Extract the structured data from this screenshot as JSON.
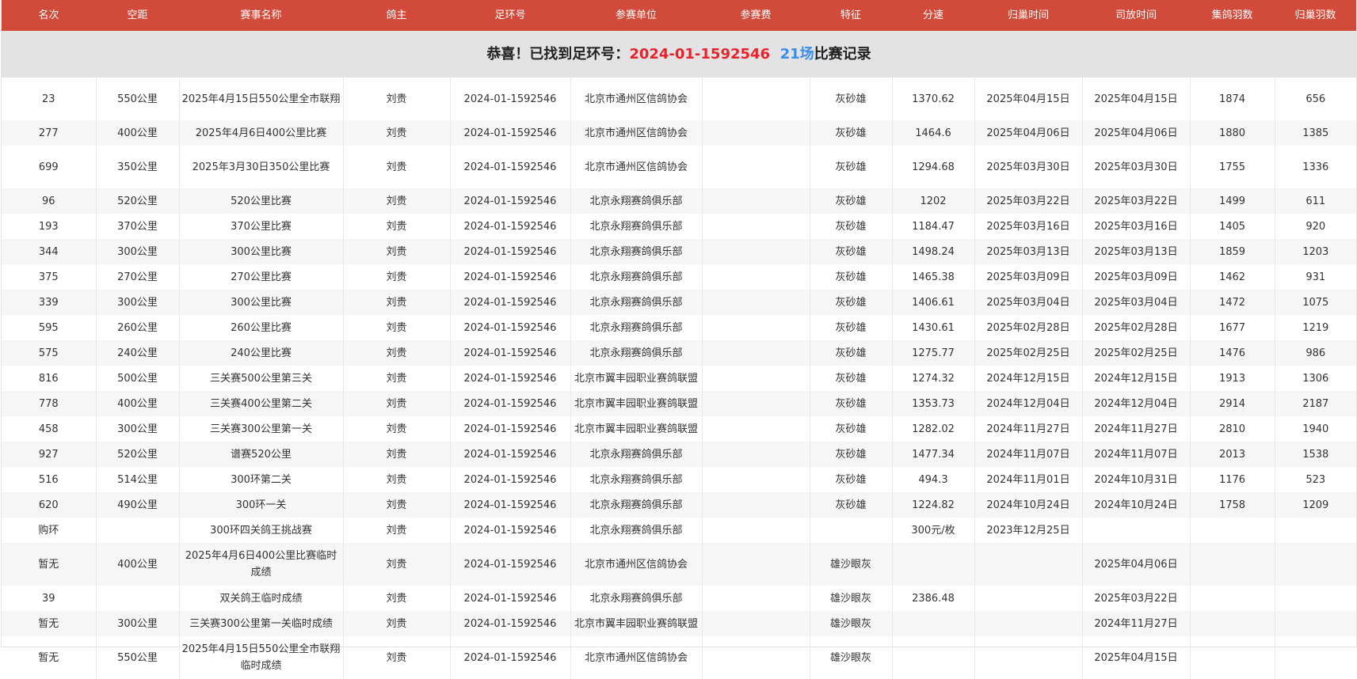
{
  "table": {
    "headers": [
      "名次",
      "空距",
      "赛事名称",
      "鸽主",
      "足环号",
      "参赛单位",
      "参赛费",
      "特征",
      "分速",
      "归巢时间",
      "司放时间",
      "集鸽羽数",
      "归巢羽数"
    ],
    "notice": {
      "prefix": "恭喜！已找到足环号：",
      "ring": "2024-01-1592546",
      "count": "21场",
      "suffix": "比赛记录"
    },
    "rows": [
      [
        "23",
        "550公里",
        "2025年4月15日550公里全市联翔",
        "刘贵",
        "2024-01-1592546",
        "北京市通州区信鸽协会",
        "",
        "灰砂雄",
        "1370.62",
        "2025年04月15日",
        "2025年04月15日",
        "1874",
        "656"
      ],
      [
        "277",
        "400公里",
        "2025年4月6日400公里比赛",
        "刘贵",
        "2024-01-1592546",
        "北京市通州区信鸽协会",
        "",
        "灰砂雄",
        "1464.6",
        "2025年04月06日",
        "2025年04月06日",
        "1880",
        "1385"
      ],
      [
        "699",
        "350公里",
        "2025年3月30日350公里比赛",
        "刘贵",
        "2024-01-1592546",
        "北京市通州区信鸽协会",
        "",
        "灰砂雄",
        "1294.68",
        "2025年03月30日",
        "2025年03月30日",
        "1755",
        "1336"
      ],
      [
        "96",
        "520公里",
        "520公里比赛",
        "刘贵",
        "2024-01-1592546",
        "北京永翔赛鸽俱乐部",
        "",
        "灰砂雄",
        "1202",
        "2025年03月22日",
        "2025年03月22日",
        "1499",
        "611"
      ],
      [
        "193",
        "370公里",
        "370公里比赛",
        "刘贵",
        "2024-01-1592546",
        "北京永翔赛鸽俱乐部",
        "",
        "灰砂雄",
        "1184.47",
        "2025年03月16日",
        "2025年03月16日",
        "1405",
        "920"
      ],
      [
        "344",
        "300公里",
        "300公里比赛",
        "刘贵",
        "2024-01-1592546",
        "北京永翔赛鸽俱乐部",
        "",
        "灰砂雄",
        "1498.24",
        "2025年03月13日",
        "2025年03月13日",
        "1859",
        "1203"
      ],
      [
        "375",
        "270公里",
        "270公里比赛",
        "刘贵",
        "2024-01-1592546",
        "北京永翔赛鸽俱乐部",
        "",
        "灰砂雄",
        "1465.38",
        "2025年03月09日",
        "2025年03月09日",
        "1462",
        "931"
      ],
      [
        "339",
        "300公里",
        "300公里比赛",
        "刘贵",
        "2024-01-1592546",
        "北京永翔赛鸽俱乐部",
        "",
        "灰砂雄",
        "1406.61",
        "2025年03月04日",
        "2025年03月04日",
        "1472",
        "1075"
      ],
      [
        "595",
        "260公里",
        "260公里比赛",
        "刘贵",
        "2024-01-1592546",
        "北京永翔赛鸽俱乐部",
        "",
        "灰砂雄",
        "1430.61",
        "2025年02月28日",
        "2025年02月28日",
        "1677",
        "1219"
      ],
      [
        "575",
        "240公里",
        "240公里比赛",
        "刘贵",
        "2024-01-1592546",
        "北京永翔赛鸽俱乐部",
        "",
        "灰砂雄",
        "1275.77",
        "2025年02月25日",
        "2025年02月25日",
        "1476",
        "986"
      ],
      [
        "816",
        "500公里",
        "三关赛500公里第三关",
        "刘贵",
        "2024-01-1592546",
        "北京市翼丰园职业赛鸽联盟",
        "",
        "灰砂雄",
        "1274.32",
        "2024年12月15日",
        "2024年12月15日",
        "1913",
        "1306"
      ],
      [
        "778",
        "400公里",
        "三关赛400公里第二关",
        "刘贵",
        "2024-01-1592546",
        "北京市翼丰园职业赛鸽联盟",
        "",
        "灰砂雄",
        "1353.73",
        "2024年12月04日",
        "2024年12月04日",
        "2914",
        "2187"
      ],
      [
        "458",
        "300公里",
        "三关赛300公里第一关",
        "刘贵",
        "2024-01-1592546",
        "北京市翼丰园职业赛鸽联盟",
        "",
        "灰砂雄",
        "1282.02",
        "2024年11月27日",
        "2024年11月27日",
        "2810",
        "1940"
      ],
      [
        "927",
        "520公里",
        "谱赛520公里",
        "刘贵",
        "2024-01-1592546",
        "北京永翔赛鸽俱乐部",
        "",
        "灰砂雄",
        "1477.34",
        "2024年11月07日",
        "2024年11月07日",
        "2013",
        "1538"
      ],
      [
        "516",
        "514公里",
        "300环第二关",
        "刘贵",
        "2024-01-1592546",
        "北京永翔赛鸽俱乐部",
        "",
        "灰砂雄",
        "494.3",
        "2024年11月01日",
        "2024年10月31日",
        "1176",
        "523"
      ],
      [
        "620",
        "490公里",
        "300环一关",
        "刘贵",
        "2024-01-1592546",
        "北京永翔赛鸽俱乐部",
        "",
        "灰砂雄",
        "1224.82",
        "2024年10月24日",
        "2024年10月24日",
        "1758",
        "1209"
      ],
      [
        "购环",
        "",
        "300环四关鸽王挑战赛",
        "刘贵",
        "2024-01-1592546",
        "北京永翔赛鸽俱乐部",
        "",
        "",
        "300元/枚",
        "2023年12月25日",
        "",
        "",
        ""
      ],
      [
        "暂无",
        "400公里",
        "2025年4月6日400公里比赛临时成绩",
        "刘贵",
        "2024-01-1592546",
        "北京市通州区信鸽协会",
        "",
        "雄沙眼灰",
        "",
        "",
        "2025年04月06日",
        "",
        ""
      ],
      [
        "39",
        "",
        "双关鸽王临时成绩",
        "刘贵",
        "2024-01-1592546",
        "北京永翔赛鸽俱乐部",
        "",
        "雄沙眼灰",
        "2386.48",
        "",
        "2025年03月22日",
        "",
        ""
      ],
      [
        "暂无",
        "300公里",
        "三关赛300公里第一关临时成绩",
        "刘贵",
        "2024-01-1592546",
        "北京市翼丰园职业赛鸽联盟",
        "",
        "雄沙眼灰",
        "",
        "",
        "2024年11月27日",
        "",
        ""
      ],
      [
        "暂无",
        "550公里",
        "2025年4月15日550公里全市联翔临时成绩",
        "刘贵",
        "2024-01-1592546",
        "北京市通州区信鸽协会",
        "",
        "雄沙眼灰",
        "",
        "",
        "2025年04月15日",
        "",
        ""
      ]
    ]
  },
  "colors": {
    "header_bg": "#d24a3a",
    "header_text": "#ffffff",
    "notice_bg": "#e3e3e3",
    "ring_highlight": "#e8222c",
    "count_highlight": "#3b8ee8"
  }
}
